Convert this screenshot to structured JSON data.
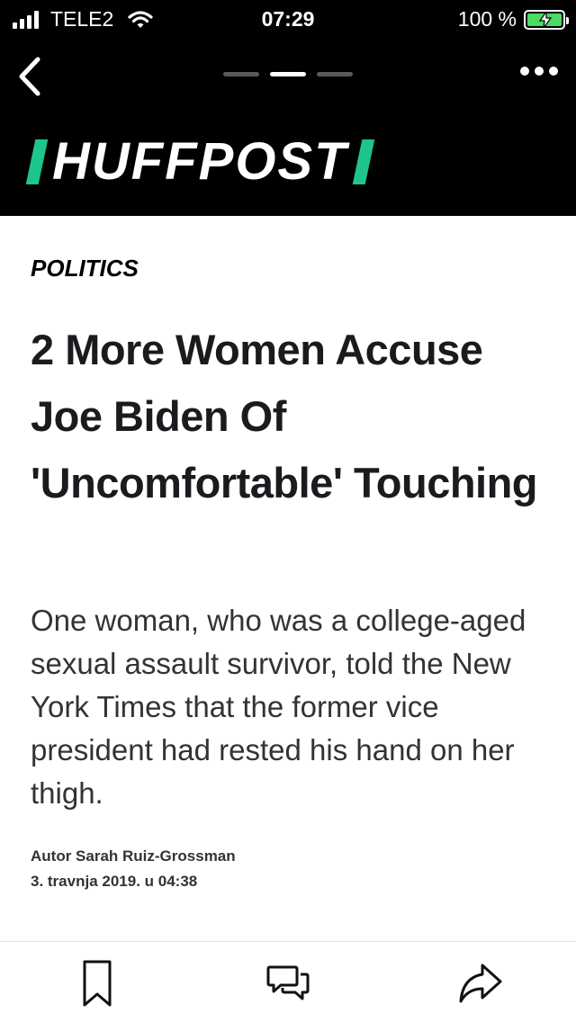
{
  "status_bar": {
    "carrier": "TELE2",
    "time": "07:29",
    "battery": "100 %"
  },
  "nav": {
    "page_count": 3,
    "active_page": 2
  },
  "brand": {
    "logo_text": "HUFFPOST",
    "accent_color": "#1ec48e"
  },
  "article": {
    "section": "POLITICS",
    "headline": "2 More Women Accuse Joe Biden Of 'Uncomfortable' Touching",
    "dek": "One woman, who was a college-aged sexual assault survivor, told the New York Times that the former vice president had rested his hand on her thigh.",
    "byline": "Autor Sarah Ruiz-Grossman",
    "date": "3. travnja 2019. u 04:38"
  },
  "toolbar": {
    "icons": [
      "bookmark-icon",
      "comments-icon",
      "share-icon"
    ]
  }
}
